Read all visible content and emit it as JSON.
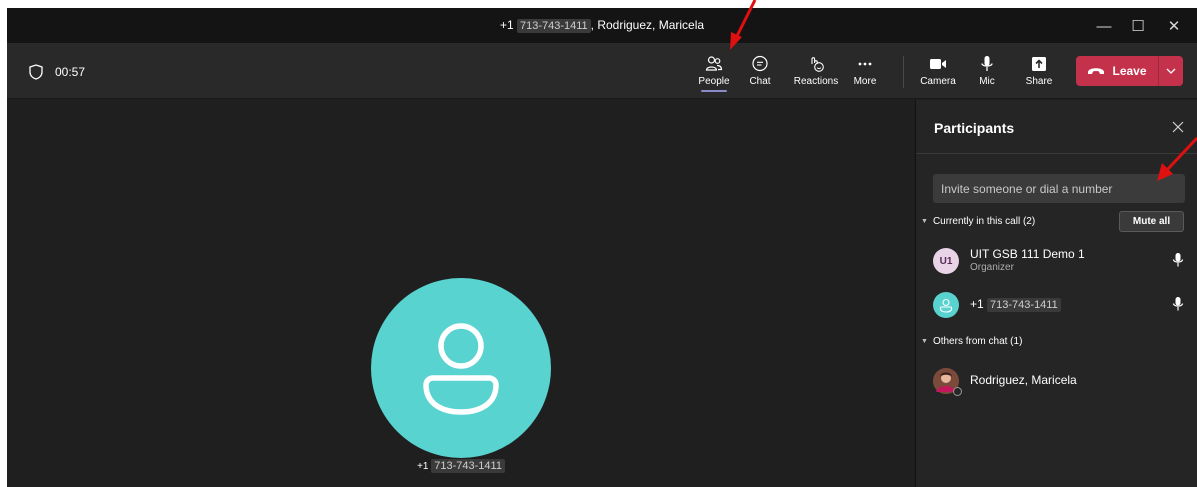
{
  "window": {
    "title_prefix": "+1",
    "title_number": "713-743-1411",
    "title_suffix": "Rodriguez, Maricela",
    "controls": {
      "minimize": "—",
      "maximize": "☐",
      "close": "✕"
    }
  },
  "toolbar": {
    "timer": "00:57",
    "buttons": [
      {
        "label": "People",
        "icon": "people-icon",
        "active": true
      },
      {
        "label": "Chat",
        "icon": "chat-icon"
      },
      {
        "label": "Reactions",
        "icon": "reactions-icon"
      },
      {
        "label": "More",
        "icon": "more-icon"
      },
      {
        "label": "Camera",
        "icon": "camera-icon"
      },
      {
        "label": "Mic",
        "icon": "mic-icon"
      },
      {
        "label": "Share",
        "icon": "share-icon"
      }
    ],
    "leave_label": "Leave"
  },
  "stage": {
    "participant_prefix": "+1",
    "participant_number": "713-743-1411",
    "avatar_color": "#58d3cf"
  },
  "panel": {
    "title": "Participants",
    "invite_placeholder": "Invite someone or dial a number",
    "in_call_section": "Currently in this call (2)",
    "mute_all": "Mute all",
    "in_call": [
      {
        "initials": "U1",
        "name": "UIT GSB 111 Demo 1",
        "role": "Organizer",
        "avatar_color": "#e8d3e7"
      },
      {
        "name_prefix": "+1",
        "name_number": "713-743-1411",
        "avatar_color": "#58d3cf"
      }
    ],
    "others_section": "Others from chat (1)",
    "others": [
      {
        "name": "Rodriguez, Maricela"
      }
    ]
  },
  "colors": {
    "leave_button": "#c4314b",
    "active_tab_underline": "#8b8cc7",
    "annotation_arrow": "#e01010"
  }
}
